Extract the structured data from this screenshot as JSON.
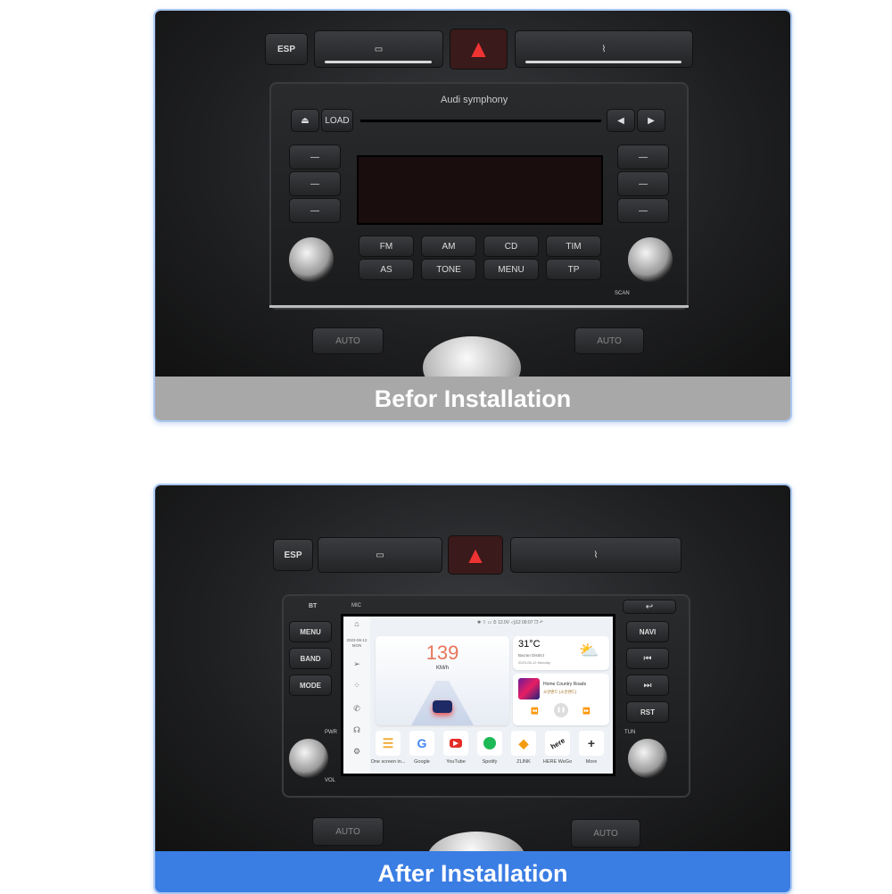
{
  "before": {
    "caption": "Befor Installation",
    "esp": "ESP",
    "brand": "Audi symphony",
    "load": "LOAD",
    "buttons_top": [
      "FM",
      "AM",
      "CD",
      "TIM"
    ],
    "buttons_bottom": [
      "AS",
      "TONE",
      "MENU",
      "TP"
    ],
    "scan": "SCAN",
    "auto_left": "AUTO",
    "auto_right": "AUTO"
  },
  "after": {
    "caption": "After Installation",
    "caption_color": "#3a7de3",
    "esp": "ESP",
    "bt": "BT",
    "mic": "MIC",
    "left_buttons": [
      "MENU",
      "BAND",
      "MODE"
    ],
    "right_buttons": [
      "NAVI",
      "⏮",
      "⏭",
      "RST"
    ],
    "pwr": "PWR",
    "vol": "VOL",
    "tun": "TUN",
    "auto_left": "AUTO",
    "auto_right": "AUTO",
    "screen": {
      "date": "2023-06-12",
      "day": "MON",
      "status": {
        "voltage": "12.0V",
        "volume": "12",
        "time": "09:07"
      },
      "speed": "139",
      "speed_unit": "KM/h",
      "weather": {
        "temp": "31°C",
        "location": "Bao'an District",
        "date": "2023-06-12 Monday"
      },
      "music": {
        "title": "Home Country Roads",
        "artist": "소란밴드 (소란밴드)"
      },
      "apps": [
        {
          "label": "One screen in...",
          "icon": "layers-icon"
        },
        {
          "label": "Google",
          "icon": "google-icon"
        },
        {
          "label": "YouTube",
          "icon": "youtube-icon"
        },
        {
          "label": "Spotify",
          "icon": "spotify-icon"
        },
        {
          "label": "ZLINK",
          "icon": "zlink-icon"
        },
        {
          "label": "HERE WeGo",
          "icon": "here-icon"
        },
        {
          "label": "More",
          "icon": "plus-icon"
        }
      ],
      "here_logo": "here"
    }
  }
}
